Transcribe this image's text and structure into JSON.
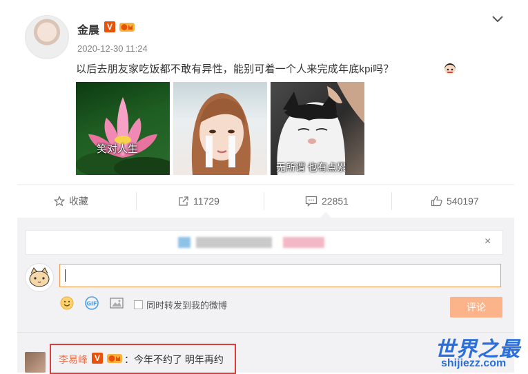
{
  "post": {
    "username": "金晨",
    "vip_badge": "V",
    "time": "2020-12-30 11:24",
    "text": "以后去朋友家吃饭都不敢有异性，能别可着一个人来完成年底kpi吗？",
    "images": [
      {
        "caption": "笑对人生"
      },
      {
        "caption": ""
      },
      {
        "caption": "无所谓 也有点累"
      }
    ]
  },
  "actions": {
    "favorite": "收藏",
    "repost": "11729",
    "comment": "22851",
    "like": "540197"
  },
  "comment_box": {
    "close": "×",
    "sync_label": "同时转发到我的微博",
    "submit": "评论"
  },
  "comment": {
    "username": "李易峰",
    "vip_badge": "V",
    "text": "：今年不约了 明年再约"
  },
  "watermark": {
    "title": "世界之最",
    "url": "shijiezz.com"
  },
  "colors": {
    "accent": "#eb7350",
    "vip": "#e8520b",
    "highlight_box": "#e03a3a",
    "submit_disabled": "#fbb38a"
  }
}
